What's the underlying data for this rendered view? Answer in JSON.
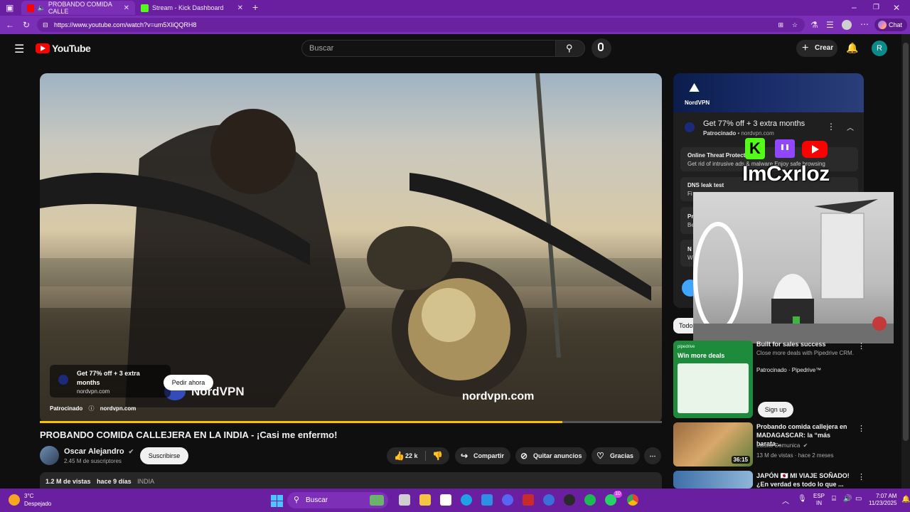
{
  "browser": {
    "tabs": [
      {
        "label": "PROBANDO COMIDA CALLE",
        "favicon_color": "#ff0000"
      },
      {
        "label": "Stream - Kick Dashboard",
        "favicon_color": "#53fc18"
      }
    ],
    "url": "https://www.youtube.com/watch?v=um5XliQQRH8",
    "chat_label": "Chat"
  },
  "youtube": {
    "logo_text": "YouTube",
    "search_placeholder": "Buscar",
    "create_label": "Crear",
    "avatar_letter": "R"
  },
  "video": {
    "progress_fraction": 0.84,
    "ad_overlay": {
      "title": "Get 77% off + 3 extra months",
      "domain": "nordvpn.com",
      "cta": "Pedir ahora",
      "sponsored_label": "Patrocinado",
      "sponsored_domain": "nordvpn.com",
      "brand_text": "NordVPN",
      "watermark_url": "nordvpn.com"
    },
    "title": "PROBANDO COMIDA CALLEJERA EN LA INDIA - ¡Casi me enfermo!",
    "channel_name": "Oscar Alejandro",
    "subscribers": "2.45 M de suscriptores",
    "subscribe_label": "Suscribirse",
    "likes": "22 k",
    "share_label": "Compartir",
    "remove_ads_label": "Quitar anuncios",
    "thanks_label": "Gracias",
    "views": "1.2 M de vistas",
    "age": "hace 9 días",
    "tag": "INDIA"
  },
  "side_ad": {
    "brand": "NordVPN",
    "title": "Get 77% off + 3 extra months",
    "sponsored": "Patrocinado",
    "domain": "nordvpn.com",
    "rows": [
      {
        "title": "Online Threat Protectio",
        "sub": "Get rid of intrusive ads & malware Enjoy safe browsing"
      },
      {
        "title": "DNS leak test",
        "sub": "Fi"
      },
      {
        "title": "Pr",
        "sub": "Be"
      },
      {
        "title": "N",
        "sub": "W"
      }
    ],
    "chip": "Todo"
  },
  "stream_overlay": {
    "username": "ImCxrloz",
    "platform_icons": [
      "kick-icon",
      "twitch-icon",
      "youtube-icon"
    ]
  },
  "recommendations": [
    {
      "title": "Built for sales success",
      "desc": "Close more deals with Pipedrive CRM.",
      "meta1": "Patrocinado · Pipedrive™",
      "thumb_label": "Win more deals",
      "thumb_brand": "pipedrive",
      "cta": "Sign up"
    },
    {
      "title": "Probando comida callejera en MADAGASCAR: la “más barata...",
      "channel": "Luisito Comunica",
      "meta": "13 M de vistas · hace 2 meses",
      "duration": "36:15"
    },
    {
      "title": "JAPÓN 🇯🇵 MI VIAJE SOÑADO! ¿En verdad es todo lo que ...",
      "channel": "",
      "meta": "",
      "duration": ""
    }
  ],
  "taskbar": {
    "weather_temp": "3°C",
    "weather_desc": "Despejado",
    "search_label": "Buscar",
    "lang1": "ESP",
    "lang2": "IN",
    "time": "7:07 AM",
    "date": "11/23/2025",
    "badge_count": "10"
  }
}
